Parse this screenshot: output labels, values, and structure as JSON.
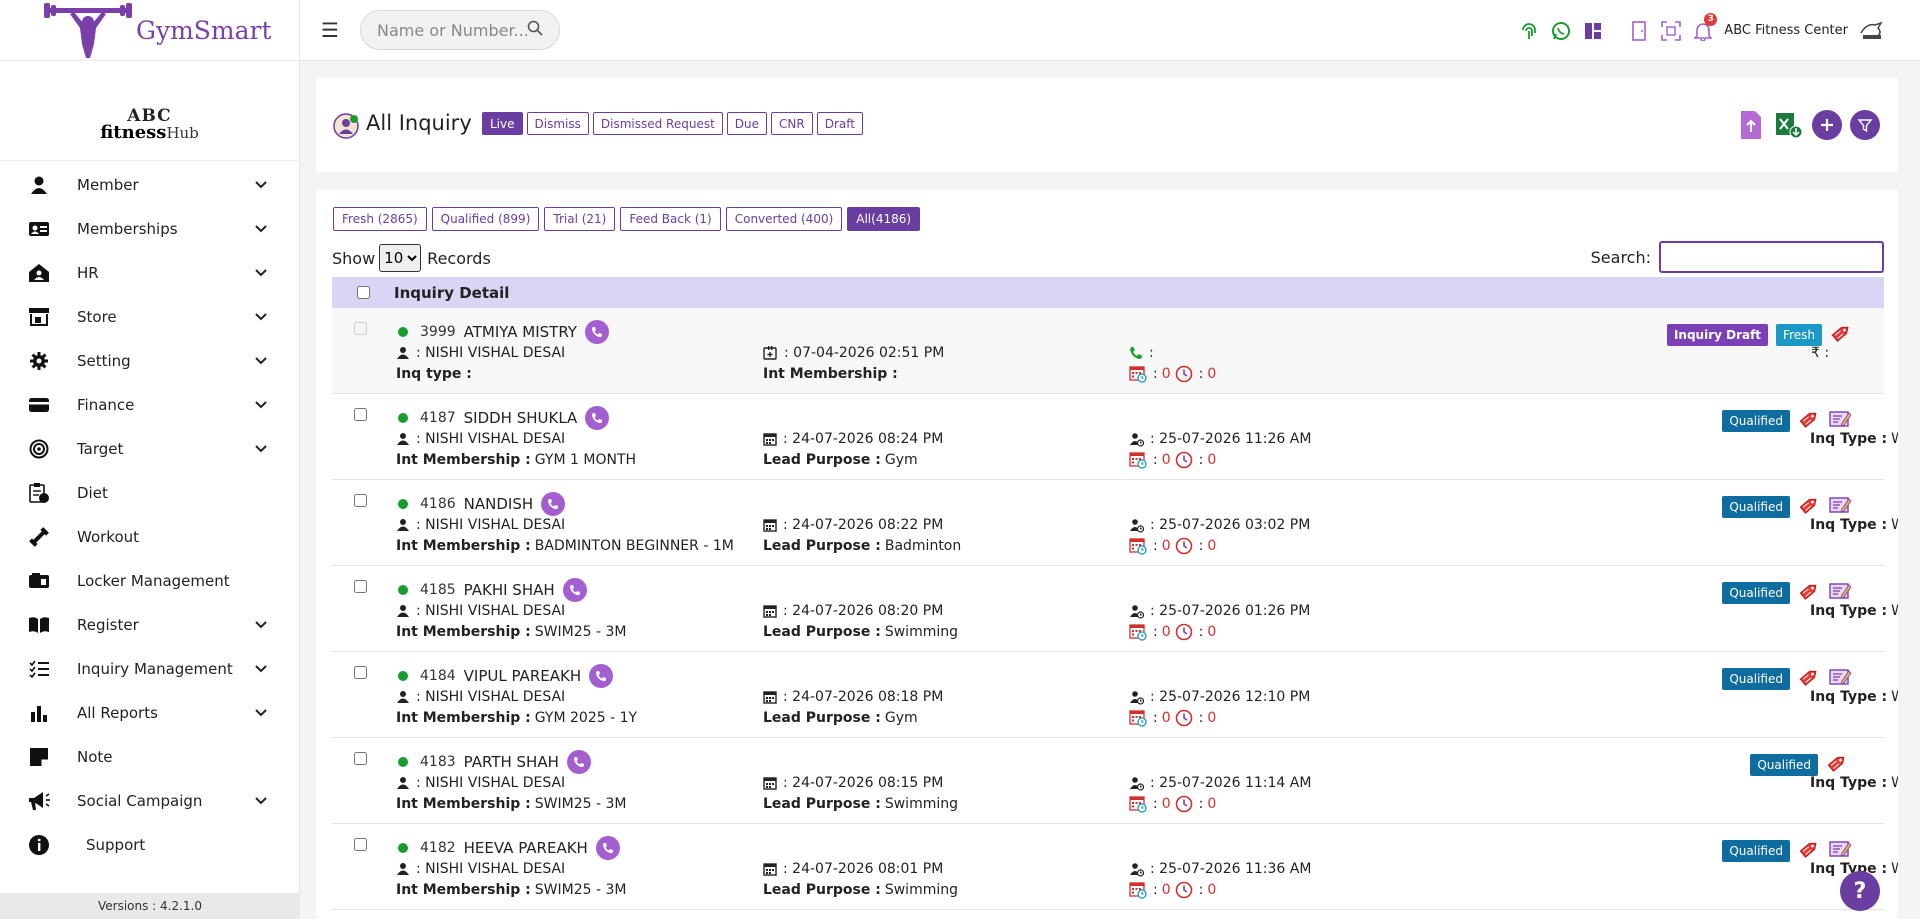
{
  "brand": {
    "name": "GymSmart"
  },
  "org": {
    "line1": "ABC",
    "line2": "fitness",
    "line2_suffix": "Hub"
  },
  "sidebar": {
    "items": [
      {
        "label": "Member",
        "icon": "user-icon",
        "has_children": true
      },
      {
        "label": "Memberships",
        "icon": "id-card-icon",
        "has_children": true
      },
      {
        "label": "HR",
        "icon": "hr-icon",
        "has_children": true
      },
      {
        "label": "Store",
        "icon": "store-icon",
        "has_children": true
      },
      {
        "label": "Setting",
        "icon": "gear-icon",
        "has_children": true
      },
      {
        "label": "Finance",
        "icon": "card-icon",
        "has_children": true
      },
      {
        "label": "Target",
        "icon": "target-icon",
        "has_children": true
      },
      {
        "label": "Diet",
        "icon": "diet-icon",
        "has_children": false
      },
      {
        "label": "Workout",
        "icon": "dumbbell-icon",
        "has_children": false
      },
      {
        "label": "Locker Management",
        "icon": "locker-icon",
        "has_children": false
      },
      {
        "label": "Register",
        "icon": "book-icon",
        "has_children": true
      },
      {
        "label": "Inquiry Management",
        "icon": "list-icon",
        "has_children": true
      },
      {
        "label": "All Reports",
        "icon": "bar-chart-icon",
        "has_children": true
      },
      {
        "label": "Note",
        "icon": "note-icon",
        "has_children": false
      },
      {
        "label": "Social Campaign",
        "icon": "megaphone-icon",
        "has_children": true
      },
      {
        "label": "Support",
        "icon": "info-icon",
        "has_children": false
      }
    ],
    "version": "Versions : 4.2.1.0"
  },
  "topbar": {
    "search_placeholder": "Name or Number...",
    "notification_count": "3",
    "center_name": "ABC Fitness Center"
  },
  "page": {
    "title": "All Inquiry",
    "status_tabs": [
      "Live",
      "Dismiss",
      "Dismissed Request",
      "Due",
      "CNR",
      "Draft"
    ],
    "active_status": "Live",
    "filter_tabs": [
      "Fresh (2865)",
      "Qualified (899)",
      "Trial (21)",
      "Feed Back (1)",
      "Converted (400)",
      "All(4186)"
    ],
    "active_filter": "All(4186)",
    "show_label": "Show",
    "records_label": "Records",
    "page_size": "10",
    "search_label": "Search:",
    "table_header": "Inquiry Detail"
  },
  "rows": [
    {
      "id": "3999",
      "name": "ATMIYA MISTRY",
      "staff": ": NISHI VISHAL DESAI",
      "l1_label": "Inq type :",
      "l1_value": "",
      "date": ": 07-04-2026 02:51 PM",
      "l2_label": "Int Membership :",
      "l2_value": "",
      "contact": ":",
      "c1": "0",
      "c2": "0",
      "inq_type_label": "",
      "inq_type": "",
      "amount": "₹ :",
      "badges": [
        "Inquiry Draft",
        "Fresh"
      ],
      "draft": true
    },
    {
      "id": "4187",
      "name": "SIDDH SHUKLA",
      "staff": ": NISHI VISHAL DESAI",
      "l1_label": "Int Membership :",
      "l1_value": "GYM 1 MONTH",
      "date": ": 24-07-2026 08:24 PM",
      "l2_label": "Lead Purpose :",
      "l2_value": "Gym",
      "contact": ": 25-07-2026 11:26 AM",
      "c1": "0",
      "c2": "0",
      "inq_type_label": "Inq Type :",
      "inq_type": "Walk in",
      "amount": "",
      "badges": [
        "Qualified"
      ],
      "draft": false
    },
    {
      "id": "4186",
      "name": "NANDISH",
      "staff": ": NISHI VISHAL DESAI",
      "l1_label": "Int Membership :",
      "l1_value": "BADMINTON BEGINNER - 1M",
      "date": ": 24-07-2026 08:22 PM",
      "l2_label": "Lead Purpose :",
      "l2_value": "Badminton",
      "contact": ": 25-07-2026 03:02 PM",
      "c1": "0",
      "c2": "0",
      "inq_type_label": "Inq Type :",
      "inq_type": "Walk in",
      "amount": "",
      "badges": [
        "Qualified"
      ],
      "draft": false
    },
    {
      "id": "4185",
      "name": "PAKHI SHAH",
      "staff": ": NISHI VISHAL DESAI",
      "l1_label": "Int Membership :",
      "l1_value": "SWIM25 - 3M",
      "date": ": 24-07-2026 08:20 PM",
      "l2_label": "Lead Purpose :",
      "l2_value": "Swimming",
      "contact": ": 25-07-2026 01:26 PM",
      "c1": "0",
      "c2": "0",
      "inq_type_label": "Inq Type :",
      "inq_type": "Walk in",
      "amount": "",
      "badges": [
        "Qualified"
      ],
      "draft": false
    },
    {
      "id": "4184",
      "name": "VIPUL PAREAKH",
      "staff": ": NISHI VISHAL DESAI",
      "l1_label": "Int Membership :",
      "l1_value": "GYM 2025 - 1Y",
      "date": ": 24-07-2026 08:18 PM",
      "l2_label": "Lead Purpose :",
      "l2_value": "Gym",
      "contact": ": 25-07-2026 12:10 PM",
      "c1": "0",
      "c2": "0",
      "inq_type_label": "Inq Type :",
      "inq_type": "Walk in",
      "amount": "",
      "badges": [
        "Qualified"
      ],
      "draft": false
    },
    {
      "id": "4183",
      "name": "PARTH SHAH",
      "staff": ": NISHI VISHAL DESAI",
      "l1_label": "Int Membership :",
      "l1_value": "SWIM25 - 3M",
      "date": ": 24-07-2026 08:15 PM",
      "l2_label": "Lead Purpose :",
      "l2_value": "Swimming",
      "contact": ": 25-07-2026 11:14 AM",
      "c1": "0",
      "c2": "0",
      "inq_type_label": "Inq Type :",
      "inq_type": "Walk in",
      "amount": "",
      "badges": [
        "Qualified"
      ],
      "draft": false,
      "no_note": true
    },
    {
      "id": "4182",
      "name": "HEEVA PAREAKH",
      "staff": ": NISHI VISHAL DESAI",
      "l1_label": "Int Membership :",
      "l1_value": "SWIM25 - 3M",
      "date": ": 24-07-2026 08:01 PM",
      "l2_label": "Lead Purpose :",
      "l2_value": "Swimming",
      "contact": ": 25-07-2026 11:36 AM",
      "c1": "0",
      "c2": "0",
      "inq_type_label": "Inq Type :",
      "inq_type": "Walk in",
      "amount": "",
      "badges": [
        "Qualified"
      ],
      "draft": false
    }
  ],
  "help": {
    "label": "?"
  },
  "colors": {
    "accent": "#6a3ea1",
    "qualified": "#0e6c9e",
    "fresh": "#1b98c6",
    "live_dot": "#1a9c2f"
  }
}
